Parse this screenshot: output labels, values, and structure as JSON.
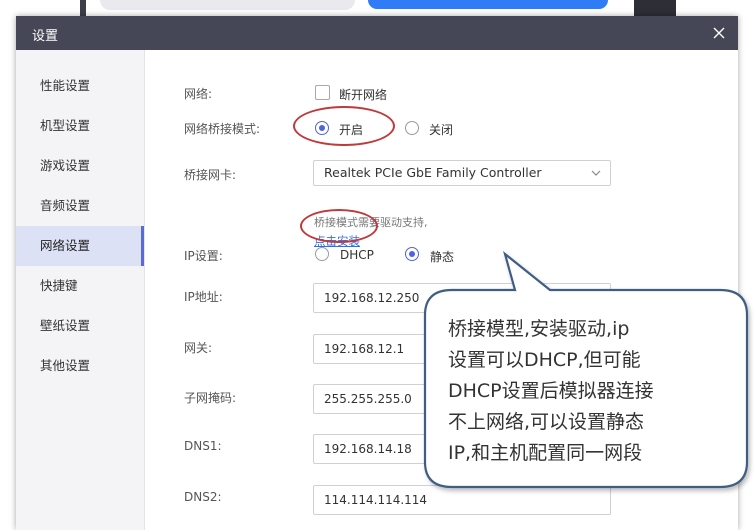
{
  "window": {
    "title": "设置"
  },
  "sidebar": {
    "items": [
      {
        "label": "性能设置"
      },
      {
        "label": "机型设置"
      },
      {
        "label": "游戏设置"
      },
      {
        "label": "音频设置"
      },
      {
        "label": "网络设置",
        "active": true
      },
      {
        "label": "快捷键"
      },
      {
        "label": "壁纸设置"
      },
      {
        "label": "其他设置"
      }
    ]
  },
  "network": {
    "label": "网络:",
    "disconnect_label": "断开网络",
    "disconnect_checked": false
  },
  "bridge_mode": {
    "label": "网络桥接模式:",
    "on_label": "开启",
    "off_label": "关闭",
    "selected": "开启"
  },
  "bridge_nic": {
    "label": "桥接网卡:",
    "value": "Realtek PCIe GbE Family Controller",
    "note": "桥接模式需要驱动支持,",
    "install_link": "点击安装"
  },
  "ip_settings": {
    "label": "IP设置:",
    "dhcp_label": "DHCP",
    "static_label": "静态",
    "selected": "静态"
  },
  "fields": {
    "ip": {
      "label": "IP地址:",
      "value": "192.168.12.250"
    },
    "gateway": {
      "label": "网关:",
      "value": "192.168.12.1"
    },
    "subnet": {
      "label": "子网掩码:",
      "value": "255.255.255.0"
    },
    "dns1": {
      "label": "DNS1:",
      "value": "192.168.14.18"
    },
    "dns2": {
      "label": "DNS2:",
      "value": "114.114.114.114"
    }
  },
  "callout": {
    "lines": [
      "桥接模型,安装驱动,ip",
      "设置可以DHCP,但可能",
      "DHCP设置后模拟器连接",
      "不上网络,可以设置静态",
      "IP,和主机配置同一网段"
    ]
  },
  "colors": {
    "titlebar": "#454756",
    "accent": "#4f63e0",
    "link": "#2f6fe0",
    "annotation": "#c0393b",
    "callout_border": "#3f5d83"
  },
  "icons": {
    "close": "close-icon",
    "dropdown": "chevron-down-icon"
  }
}
